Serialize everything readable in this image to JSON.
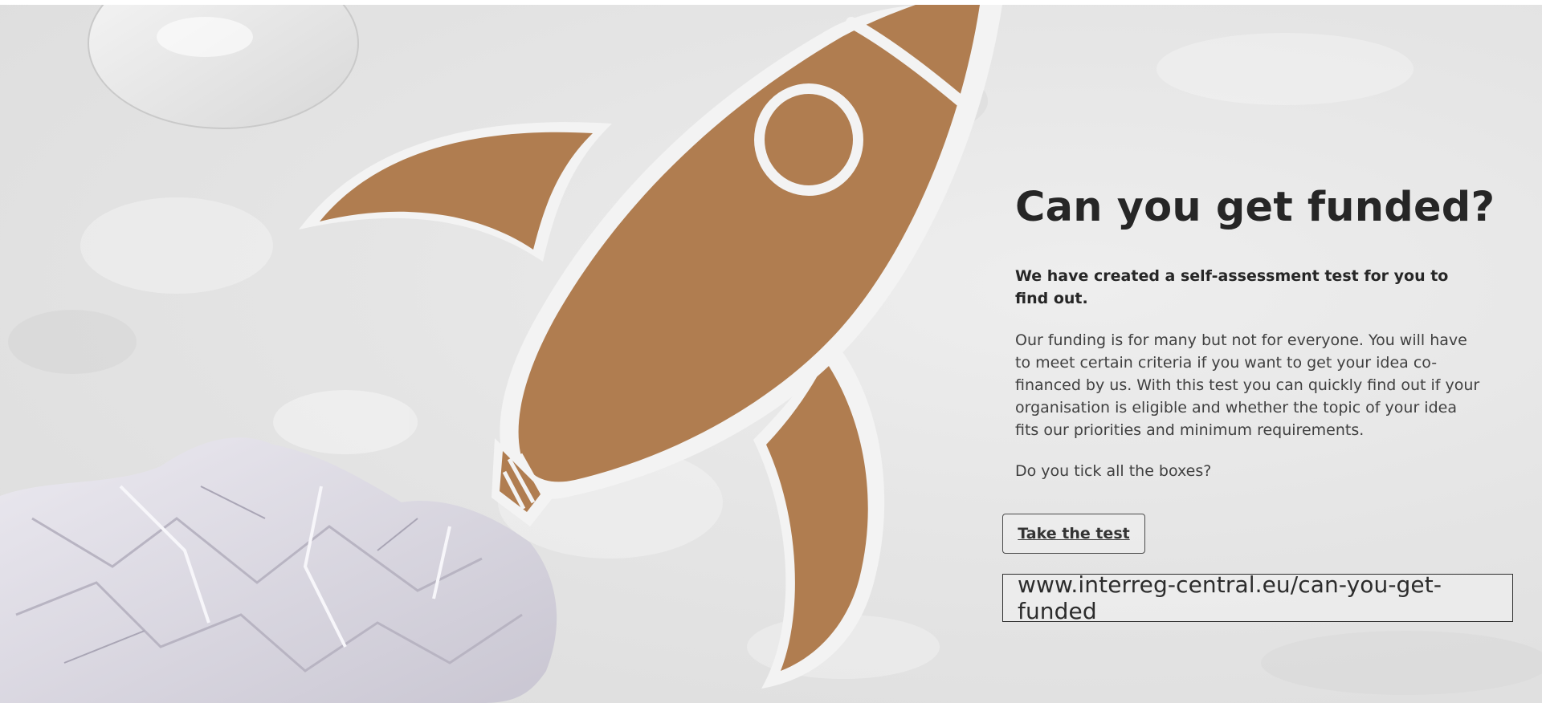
{
  "content": {
    "headline": "Can you get funded?",
    "lead": "We have created a self-assessment test for you to find out.",
    "body": "Our funding is for many but not for everyone. You will have to meet certain criteria if you want to get your idea co-financed by us. With this test you can quickly find out if your organisation is eligible and whether the topic of your idea fits our priorities and minimum requirements.",
    "question": "Do you tick all the boxes?",
    "cta_label": "Take the test",
    "url": "www.interreg-central.eu/can-you-get-funded"
  },
  "colors": {
    "cardboard": "#b07d50",
    "paper_white": "#f4f4f4",
    "background": "#e4e4e4",
    "text_dark": "#262626"
  },
  "icons": {
    "rocket": "cardboard-rocket-illustration",
    "moon": "paper-moon-illustration",
    "crumpled_paper": "crumpled-paper-illustration"
  }
}
